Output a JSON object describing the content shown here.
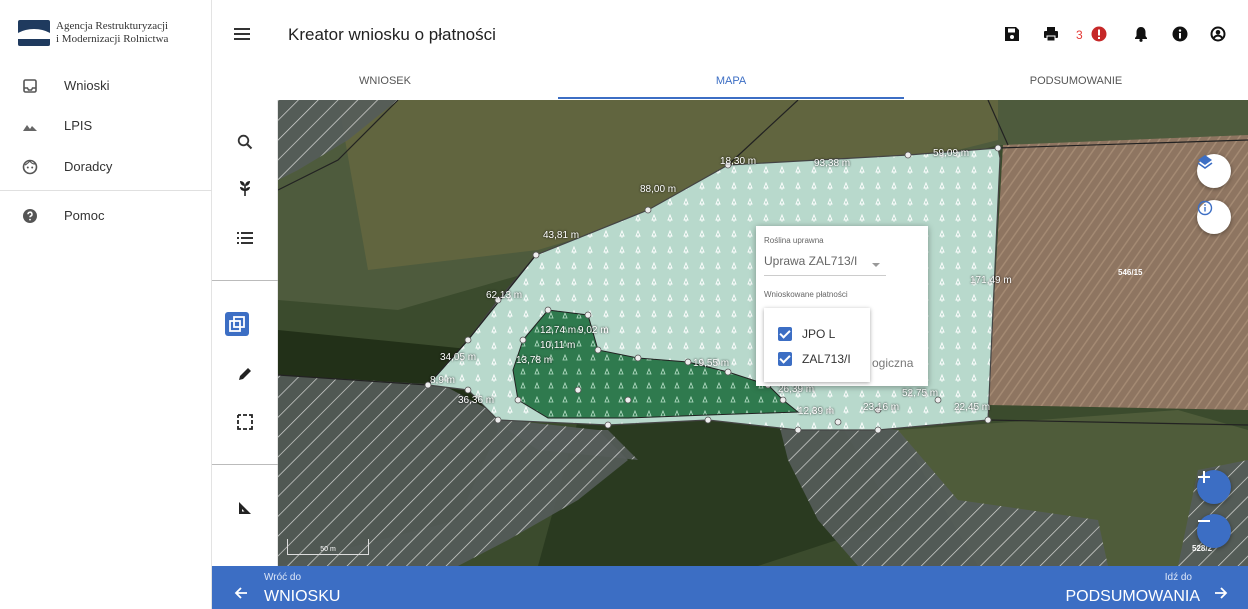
{
  "logo": {
    "line1": "Agencja Restrukturyzacji",
    "line2": "i Modernizacji Rolnictwa",
    "mark_text": "ARiMR"
  },
  "sidebar": {
    "items": [
      {
        "label": "Wnioski",
        "icon": "inbox-icon"
      },
      {
        "label": "LPIS",
        "icon": "terrain-icon"
      },
      {
        "label": "Doradcy",
        "icon": "face-icon"
      },
      {
        "label": "Pomoc",
        "icon": "help-icon"
      }
    ]
  },
  "header": {
    "title": "Kreator wniosku o płatności",
    "error_count": "3",
    "icons": [
      "save-icon",
      "print-icon",
      "error-icon",
      "bell-icon",
      "info-icon",
      "account-icon"
    ]
  },
  "tabs": [
    {
      "label": "WNIOSEK"
    },
    {
      "label": "MAPA",
      "active": true
    },
    {
      "label": "PODSUMOWANIE"
    }
  ],
  "tools": [
    "search-icon",
    "plant-icon",
    "list-icon",
    "layers-copy-icon",
    "pencil-icon",
    "select-area-icon",
    "measure-icon"
  ],
  "map": {
    "parcels": [
      "546/15",
      "528/2"
    ],
    "scale": "50 m",
    "measurements": [
      "18,30 m",
      "93,38 m",
      "59,09 m",
      "88,00 m",
      "43,81 m",
      "171,49 m",
      "62,13 m",
      "34,05 m",
      "8,9 m",
      "36,36 m",
      "52,75 m",
      "22,45 m",
      "23,16 m",
      "12,39 m",
      "26,39 m",
      "19,55 m",
      "10,11 m",
      "9,02 m",
      "12,74 m",
      "13,78 m"
    ],
    "colors": {
      "selected_parcel": "#b8d9cc",
      "inner_parcel": "#2f7a4e",
      "satellite": "#38482a",
      "hatch": "#e9e9e9"
    }
  },
  "popup": {
    "crop_label": "Roślina uprawna",
    "crop_value": "Uprawa ZAL713/I",
    "payments_label": "Wnioskowane płatności",
    "payments": [
      {
        "label": "JPO L",
        "checked": true
      },
      {
        "label": "ZAL713/I",
        "checked": true
      }
    ],
    "obscured_text": "ogiczna"
  },
  "bottom": {
    "back_small": "Wróć do",
    "back_big": "WNIOSKU",
    "next_small": "Idź do",
    "next_big": "PODSUMOWANIA"
  },
  "colors": {
    "accent": "#3c6ec4",
    "error": "#e53935"
  }
}
